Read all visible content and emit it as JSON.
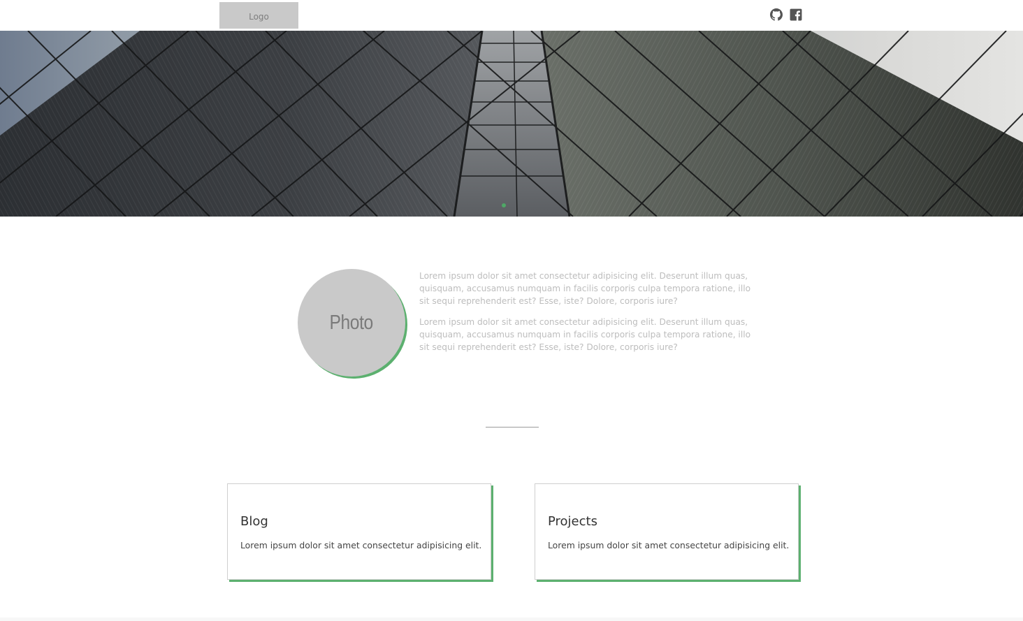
{
  "header": {
    "logo_label": "Logo",
    "social": [
      {
        "icon": "github-icon"
      },
      {
        "icon": "facebook-icon"
      }
    ]
  },
  "hero": {
    "carousel_active_index": 0,
    "accent_color": "#4fa866"
  },
  "about": {
    "photo_label": "Photo",
    "paragraphs": [
      "Lorem ipsum dolor sit amet consectetur adipisicing elit. Deserunt illum quas, quisquam, accusamus numquam in facilis corporis culpa tempora ratione, illo sit sequi reprehenderit est? Esse, iste? Dolore, corporis iure?",
      "Lorem ipsum dolor sit amet consectetur adipisicing elit. Deserunt illum quas, quisquam, accusamus numquam in facilis corporis culpa tempora ratione, illo sit sequi reprehenderit est? Esse, iste? Dolore, corporis iure?"
    ]
  },
  "cards": [
    {
      "title": "Blog",
      "text": "Lorem ipsum dolor sit amet consectetur adipisicing elit."
    },
    {
      "title": "Projects",
      "text": "Lorem ipsum dolor sit amet consectetur adipisicing elit."
    }
  ],
  "colors": {
    "accent": "#5cb06f",
    "placeholder_gray": "#c9c9c9"
  }
}
